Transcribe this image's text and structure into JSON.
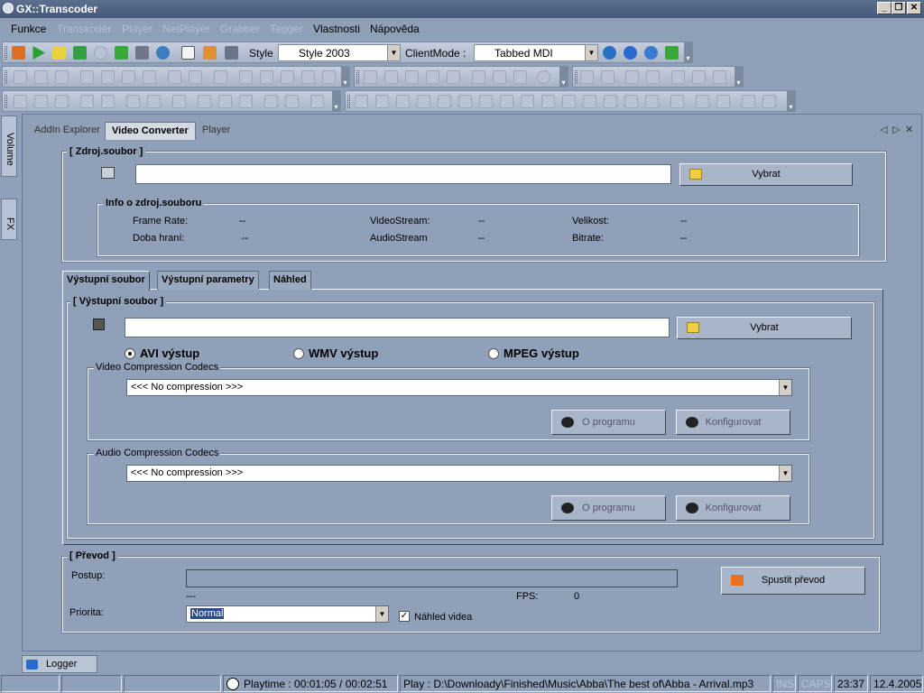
{
  "window": {
    "title": "GX::Transcoder",
    "controls": [
      "_",
      "❐",
      "✕"
    ]
  },
  "menu": [
    {
      "label": "Funkce",
      "enabled": true
    },
    {
      "label": "Transkodér",
      "enabled": false
    },
    {
      "label": "Player",
      "enabled": false
    },
    {
      "label": "NetPlayer",
      "enabled": false
    },
    {
      "label": "Grabber",
      "enabled": false
    },
    {
      "label": "Tagger",
      "enabled": false
    },
    {
      "label": "Vlastnosti",
      "enabled": true
    },
    {
      "label": "Nápověda",
      "enabled": true
    }
  ],
  "toolbar": {
    "style_label": "Style",
    "style_value": "Style 2003",
    "clientmode_label": "ClientMode :",
    "clientmode_value": "Tabbed MDI"
  },
  "side_tabs": {
    "volume": "Volume",
    "fx": "FX"
  },
  "doc_tabs": [
    {
      "label": "AddIn Explorer",
      "active": false
    },
    {
      "label": "Video Converter",
      "active": true
    },
    {
      "label": "Player",
      "active": false
    }
  ],
  "source": {
    "title": "[ Zdroj.soubor ]",
    "path_value": "",
    "browse_label": "Vybrat",
    "info_title": "Info o zdroj.souboru",
    "info": {
      "frame_rate_label": "Frame Rate:",
      "frame_rate_value": "--",
      "duration_label": "Doba hraní:",
      "duration_value": "--",
      "videostream_label": "VideoStream:",
      "videostream_value": "--",
      "audiostream_label": "AudioStream",
      "audiostream_value": "--",
      "size_label": "Velikost:",
      "size_value": "--",
      "bitrate_label": "Bitrate:",
      "bitrate_value": "--"
    }
  },
  "output_tabs": [
    {
      "label": "Výstupní soubor",
      "active": true
    },
    {
      "label": "Výstupní parametry",
      "active": false
    },
    {
      "label": "Náhled",
      "active": false
    }
  ],
  "output": {
    "title": "[ Výstupní soubor ]",
    "path_value": "",
    "browse_label": "Vybrat",
    "formats": [
      {
        "label": "AVI výstup",
        "selected": true
      },
      {
        "label": "WMV výstup",
        "selected": false
      },
      {
        "label": "MPEG výstup",
        "selected": false
      }
    ],
    "video_codecs_title": "Video Compression Codecs",
    "video_codec_value": "<<< No compression >>>",
    "audio_codecs_title": "Audio Compression Codecs",
    "audio_codec_value": "<<< No compression >>>",
    "about_label": "O programu",
    "configure_label": "Konfigurovat"
  },
  "conversion": {
    "title": "[ Převod ]",
    "progress_label": "Postup:",
    "progress_fraction": 0,
    "progress_text": "---",
    "fps_label": "FPS:",
    "fps_value": "0",
    "start_label": "Spustit převod",
    "priority_label": "Priorita:",
    "priority_value": "Normal",
    "preview_label": "Náhled videa",
    "preview_checked": true
  },
  "logger_tab": "Logger",
  "status": {
    "playtime": "Playtime : 00:01:05 / 00:02:51",
    "play": "Play : D:\\Downloady\\Finished\\Music\\Abba\\The best of\\Abba - Arrival.mp3",
    "ins": "INS",
    "caps": "CAPS",
    "time": "23:37",
    "date": "12.4.2005"
  },
  "colors": {
    "accent_titlebar": "#46597a",
    "panel": "#8fa0b8",
    "toolbar": "#b3bfd0"
  }
}
